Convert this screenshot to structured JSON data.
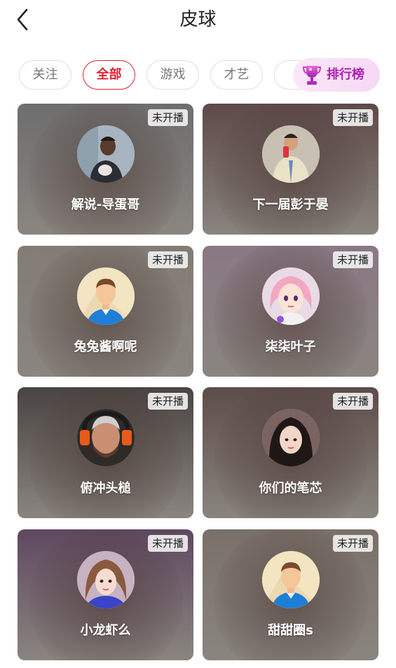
{
  "header": {
    "title": "皮球"
  },
  "tabs": [
    {
      "label": "关注"
    },
    {
      "label": "全部",
      "active": true
    },
    {
      "label": "游戏"
    },
    {
      "label": "才艺"
    },
    {
      "label": ""
    }
  ],
  "ranking": {
    "label": "排行榜",
    "icon": "trophy-icon"
  },
  "streamers": [
    {
      "name": "解说-导蛋哥",
      "status": "未开播",
      "bg": "#6e6e6e",
      "avatar": "photo-man-dark",
      "avatar_bg": "#a8b4c0"
    },
    {
      "name": "下一届彭于晏",
      "status": "未开播",
      "bg": "#5e4a48",
      "avatar": "photo-man-light",
      "avatar_bg": "#c9c0b4"
    },
    {
      "name": "兔兔酱啊呢",
      "status": "未开播",
      "bg": "#837c74",
      "avatar": "default-avatar",
      "avatar_bg": "#f3e4c2"
    },
    {
      "name": "柒柒叶子",
      "status": "未开播",
      "bg": "#8a7884",
      "avatar": "anime-girl",
      "avatar_bg": "#e8dbe6"
    },
    {
      "name": "俯冲头槌",
      "status": "未开播",
      "bg": "#4a4442",
      "avatar": "photo-gamer",
      "avatar_bg": "#2e2a28"
    },
    {
      "name": "你们的笔芯",
      "status": "未开播",
      "bg": "#5d4c4a",
      "avatar": "photo-woman-dark",
      "avatar_bg": "#7a6360"
    },
    {
      "name": "小龙虾么",
      "status": "未开播",
      "bg": "#5f4860",
      "avatar": "photo-woman-light",
      "avatar_bg": "#c7b2c2"
    },
    {
      "name": "甜甜圈s",
      "status": "未开播",
      "bg": "#7a7068",
      "avatar": "default-avatar",
      "avatar_bg": "#f3e4c2"
    }
  ]
}
